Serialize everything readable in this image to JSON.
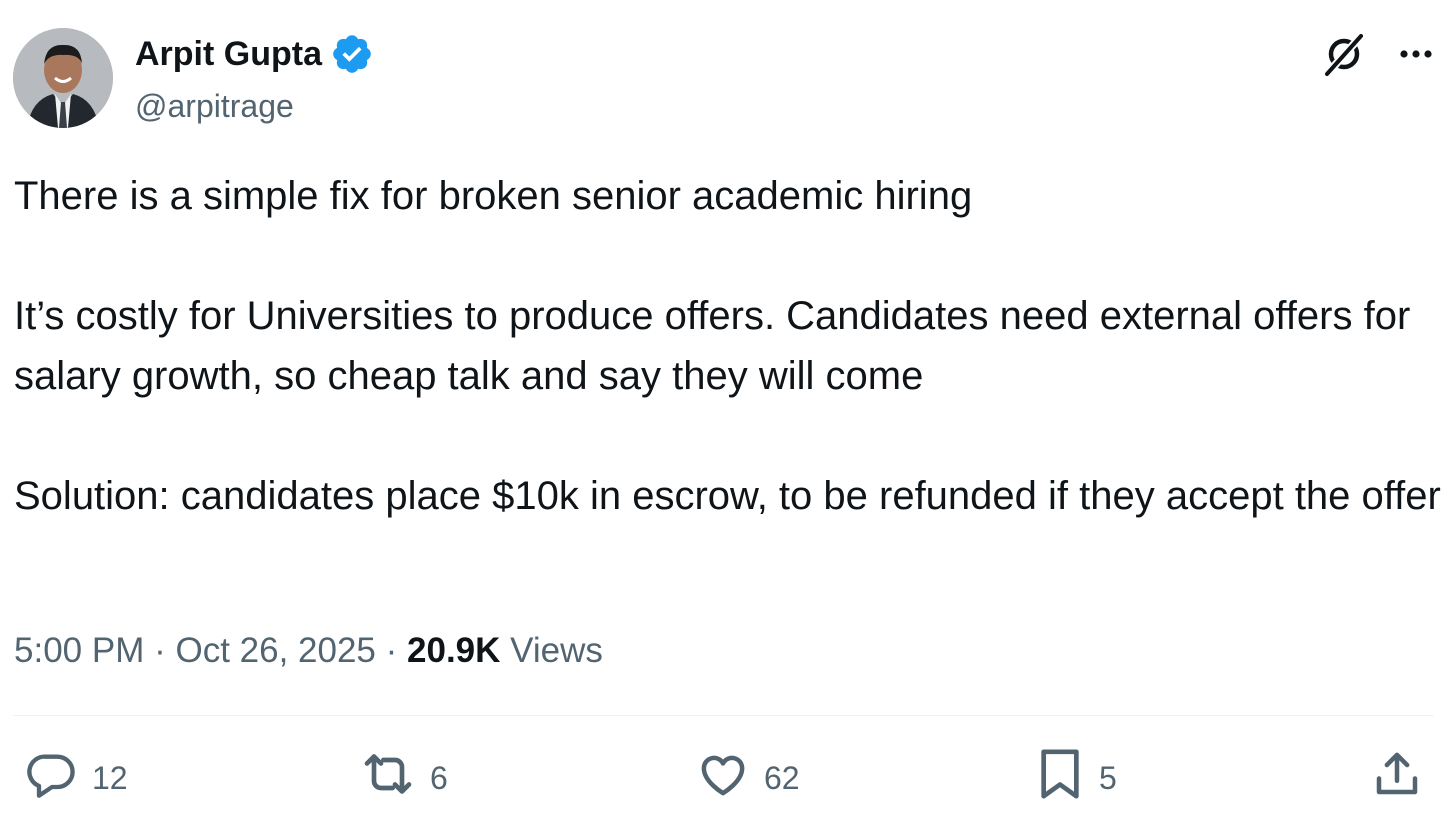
{
  "author": {
    "name": "Arpit Gupta",
    "handle": "@arpitrage",
    "verified": true,
    "verified_color": "#1d9bf0"
  },
  "tweet": {
    "paragraphs": [
      "There is a simple fix for broken senior academic hiring",
      "It’s costly for Universities to produce offers. Candidates need external offers for salary growth, so cheap talk and say they will come",
      "Solution: candidates place $10k in escrow, to be refunded if they accept the offer"
    ],
    "time": "5:00 PM",
    "date": "Oct 26, 2025",
    "separator": "·",
    "views_count": "20.9K",
    "views_label": "Views"
  },
  "top_actions": {
    "grok_icon": "grok-icon",
    "more_icon": "more-icon"
  },
  "engagement": {
    "replies": "12",
    "reposts": "6",
    "likes": "62",
    "bookmarks": "5"
  },
  "colors": {
    "text": "#0f1419",
    "secondary": "#536471",
    "divider": "#eff3f4"
  }
}
